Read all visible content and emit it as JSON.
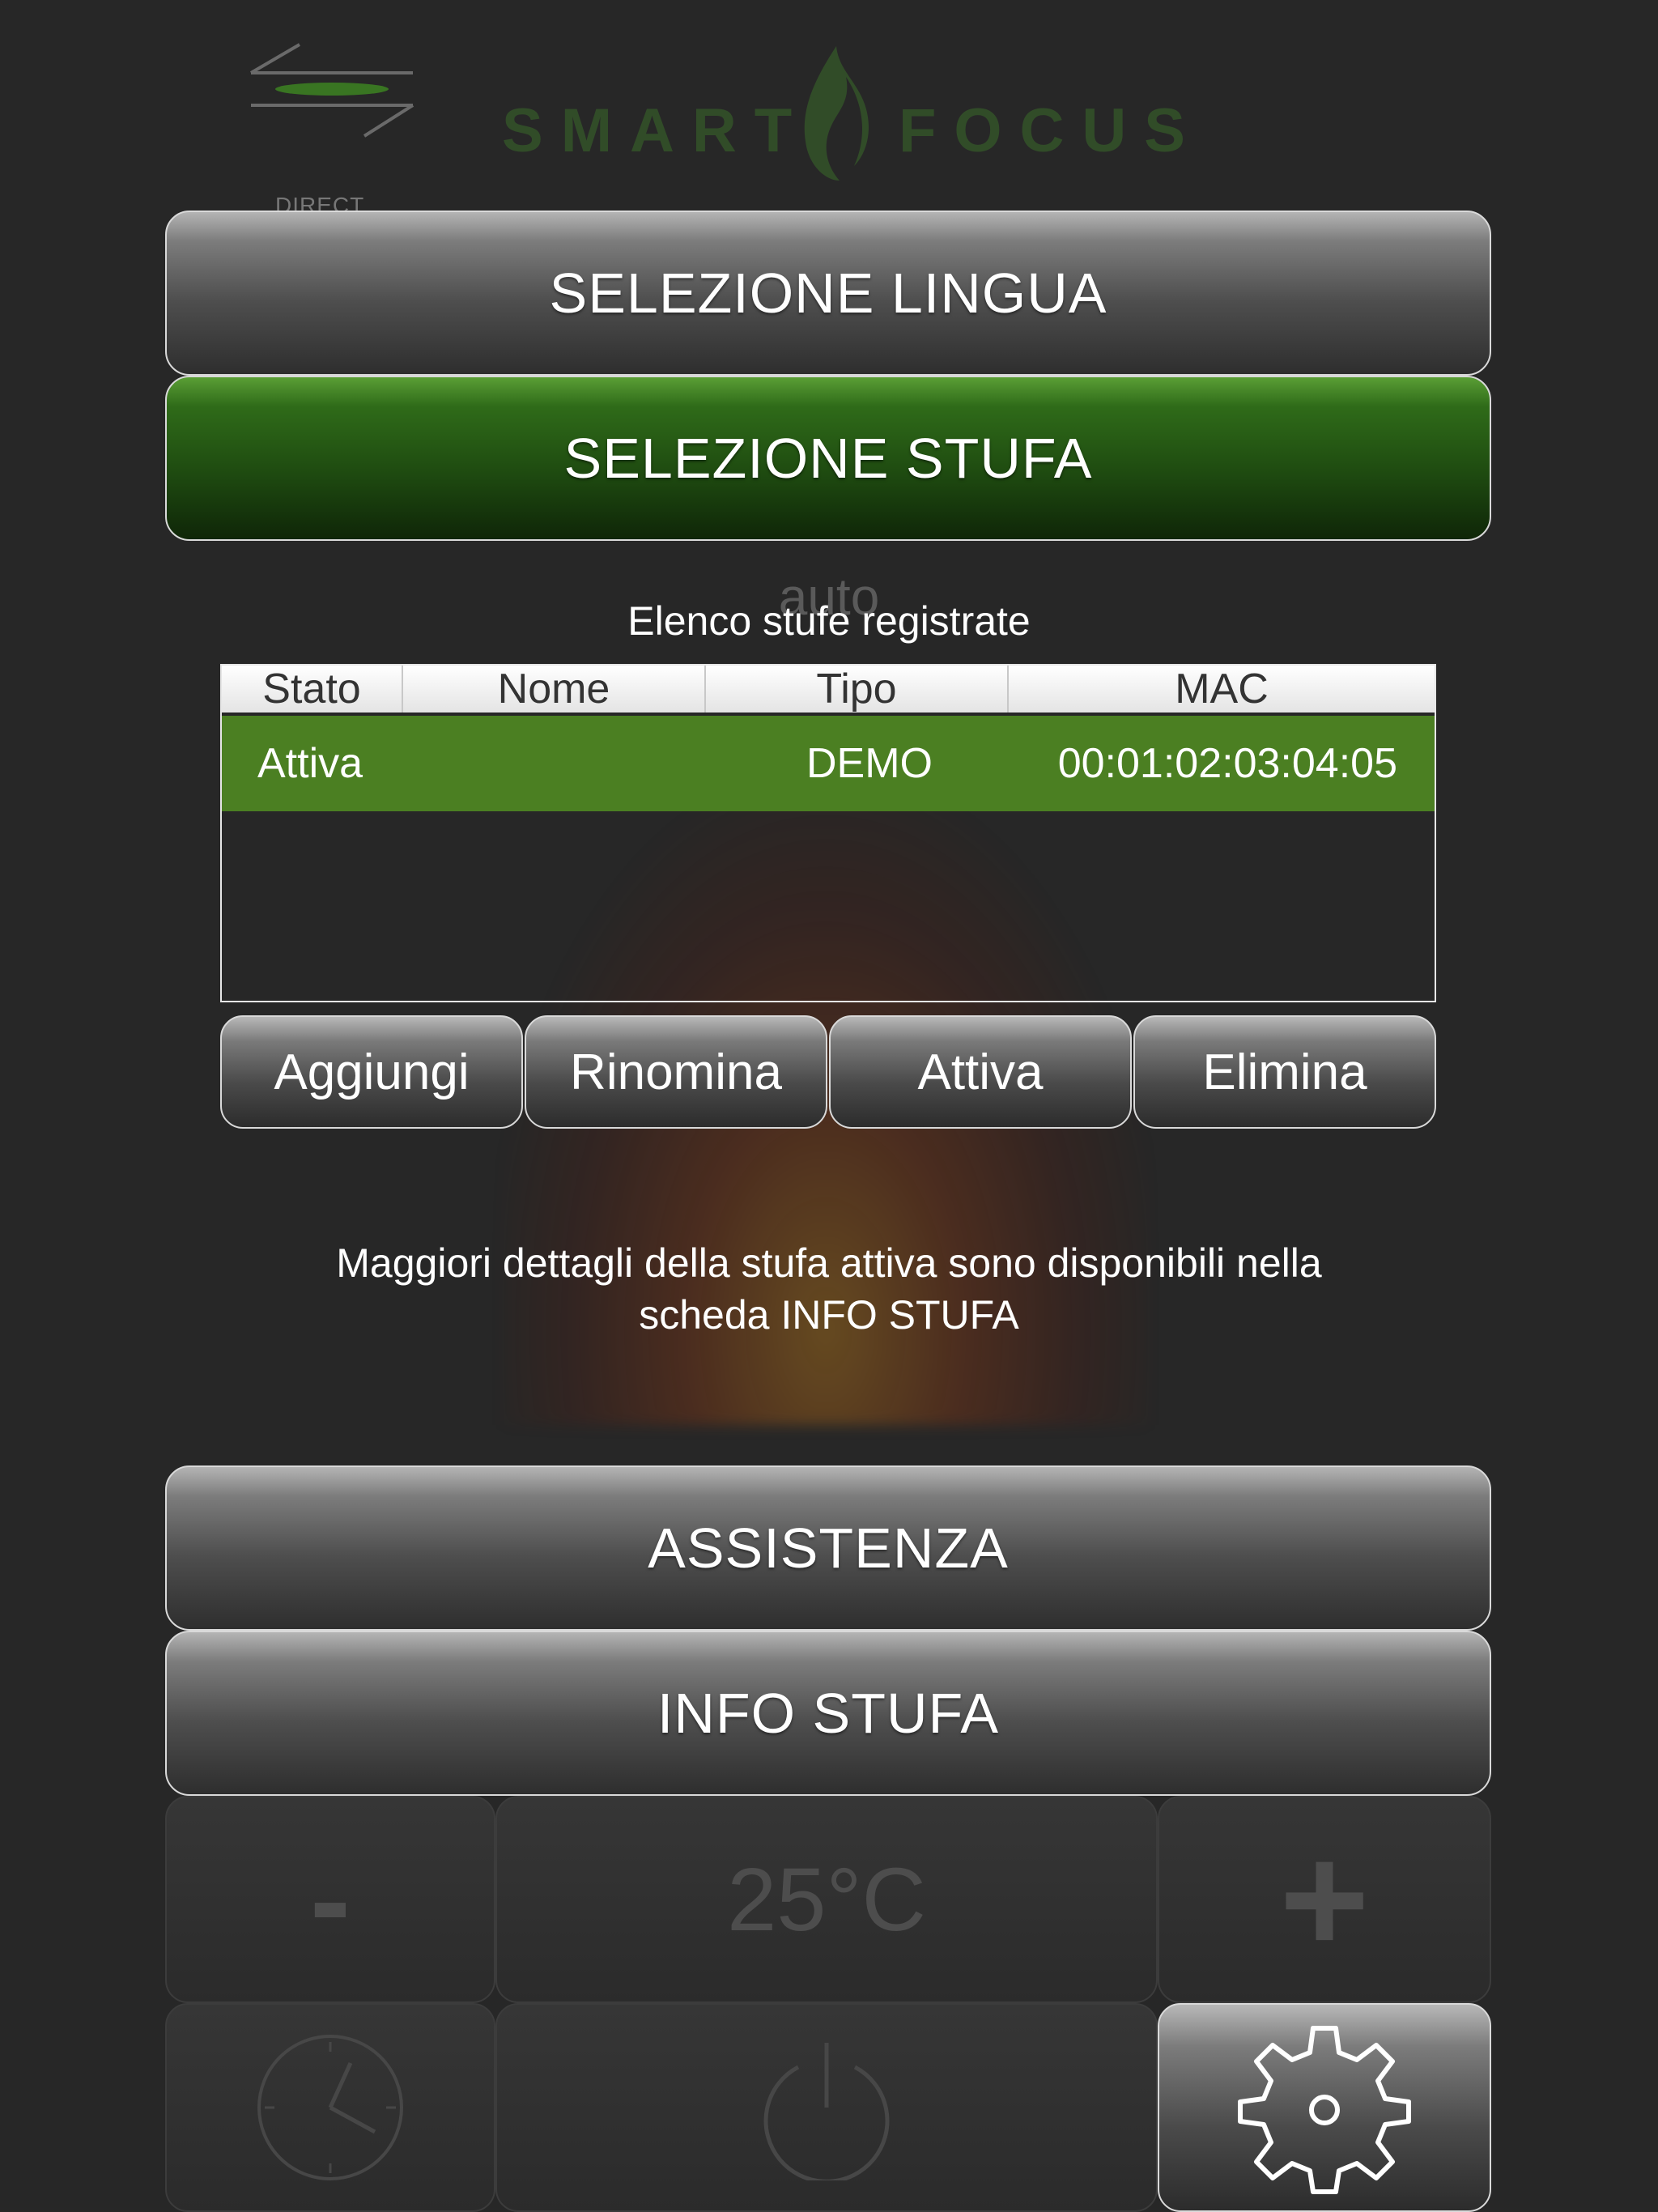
{
  "header": {
    "direct_label": "DIRECT",
    "brand_left": "SMART",
    "brand_right": "FOCUS"
  },
  "menu": {
    "language": "SELEZIONE LINGUA",
    "stove": "SELEZIONE STUFA",
    "assistance": "ASSISTENZA",
    "stove_info": "INFO STUFA"
  },
  "stove_section": {
    "ghost_label": "auto",
    "list_title": "Elenco stufe registrate",
    "columns": [
      "Stato",
      "Nome",
      "Tipo",
      "MAC"
    ],
    "rows": [
      {
        "state": "Attiva",
        "name": "",
        "type": "DEMO",
        "mac": "00:01:02:03:04:05"
      }
    ],
    "actions": [
      "Aggiungi",
      "Rinomina",
      "Attiva",
      "Elimina"
    ],
    "info_text_line1": "Maggiori dettagli della stufa attiva sono disponibili nella",
    "info_text_line2": "scheda INFO STUFA"
  },
  "controls": {
    "minus_label": "-",
    "temperature": "25°C",
    "plus_label": "+"
  },
  "colors": {
    "background": "#272727",
    "active_row": "#4b7f22",
    "brand_green": "#3f7a2a"
  }
}
